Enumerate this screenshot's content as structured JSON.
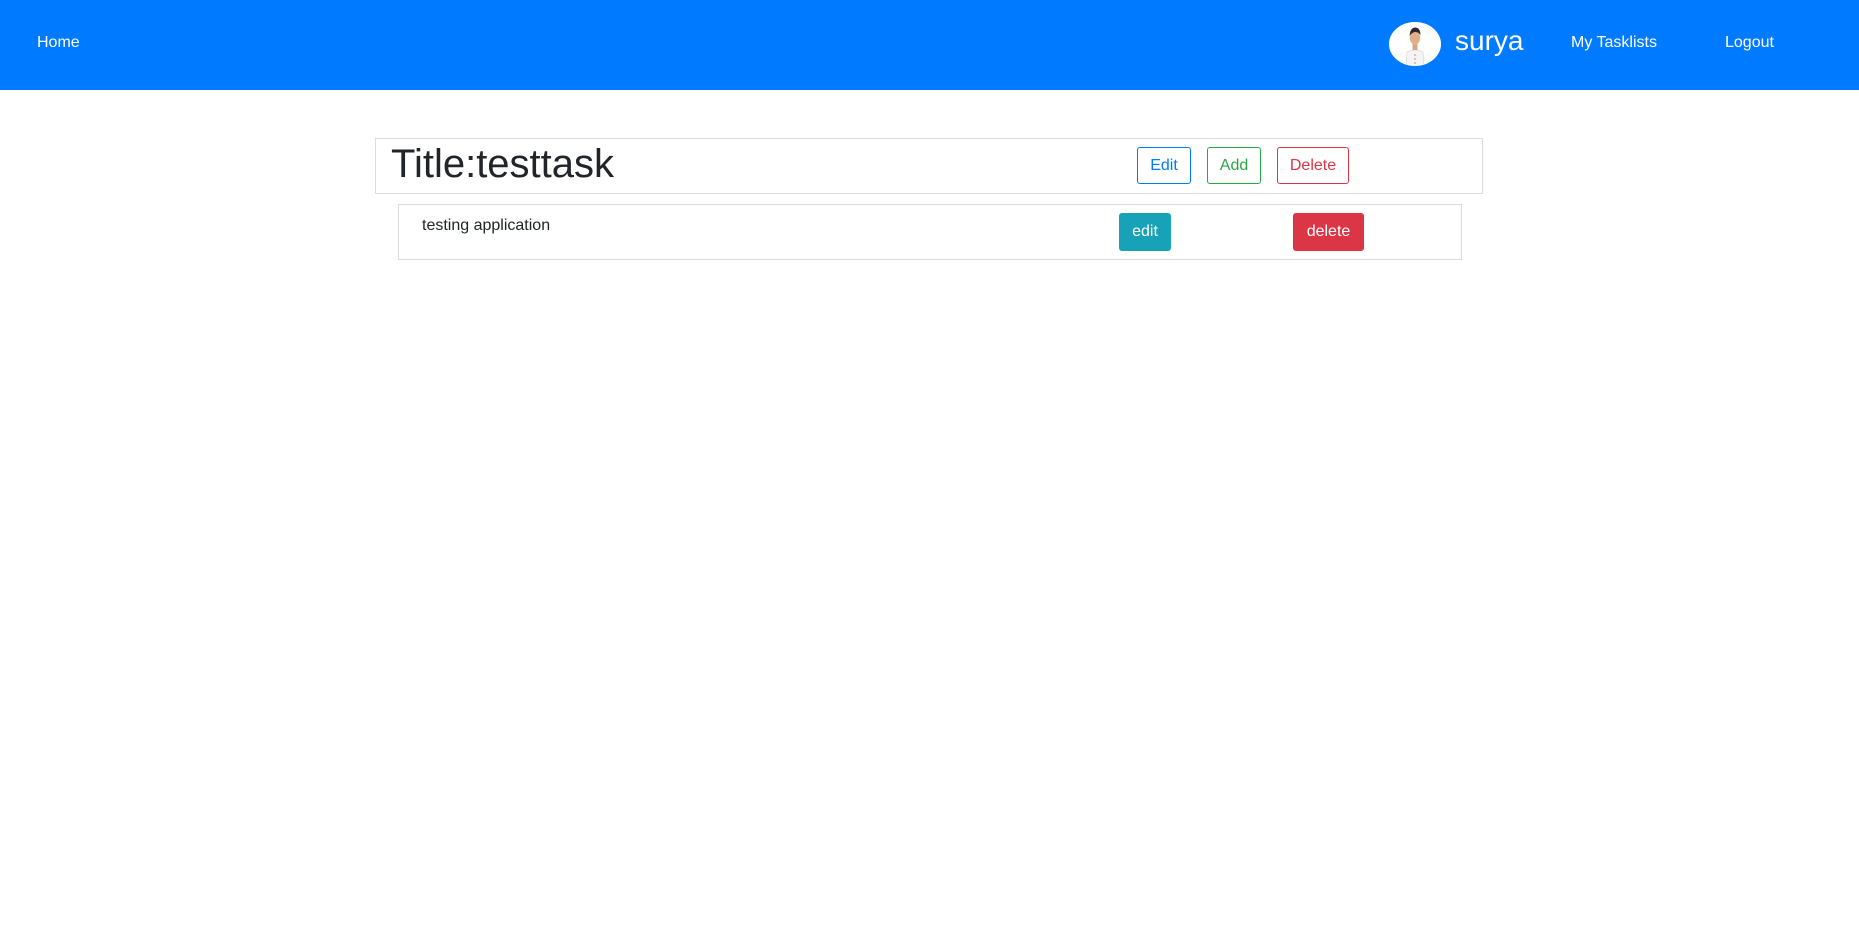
{
  "navbar": {
    "home_label": "Home",
    "username": "surya",
    "tasklists_label": "My Tasklists",
    "logout_label": "Logout",
    "background_color": "#007bff",
    "avatar_icon": "user-avatar-icon"
  },
  "tasklist": {
    "title": "Title:testtask",
    "edit_label": "Edit",
    "add_label": "Add",
    "delete_label": "Delete"
  },
  "tasks": [
    {
      "text": "testing application",
      "edit_label": "edit",
      "delete_label": "delete"
    }
  ],
  "colors": {
    "primary": "#007bff",
    "success": "#28a745",
    "danger": "#dc3545",
    "info": "#17a2b8"
  }
}
